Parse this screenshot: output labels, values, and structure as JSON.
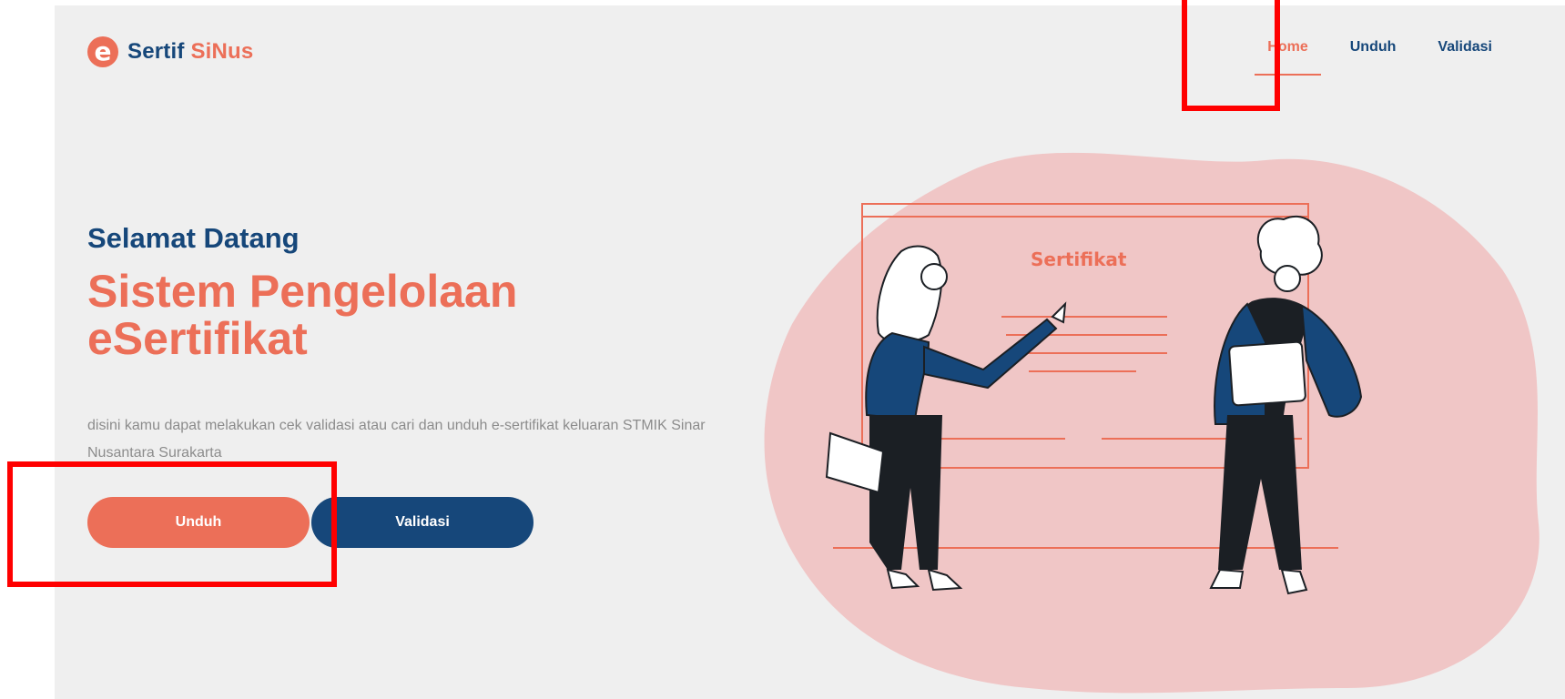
{
  "header": {
    "logo": {
      "mark": "e",
      "name_part1": "Sertif",
      "name_part2": "SiNus"
    },
    "nav": [
      {
        "label": "Home",
        "active": true
      },
      {
        "label": "Unduh",
        "active": false
      },
      {
        "label": "Validasi",
        "active": false
      }
    ]
  },
  "hero": {
    "welcome": "Selamat Datang",
    "headline": "Sistem Pengelolaan eSertifikat",
    "description": "disini kamu dapat melakukan cek validasi atau cari dan unduh e-sertifikat keluaran STMIK Sinar Nusantara Surakarta",
    "unduh_label": "Unduh",
    "validasi_label": "Validasi"
  },
  "illustration": {
    "certificate_title": "Sertifikat"
  },
  "colors": {
    "primary": "#16477a",
    "accent": "#ec6f58",
    "blob": "#f0c6c6",
    "annotation": "#ff0000"
  }
}
